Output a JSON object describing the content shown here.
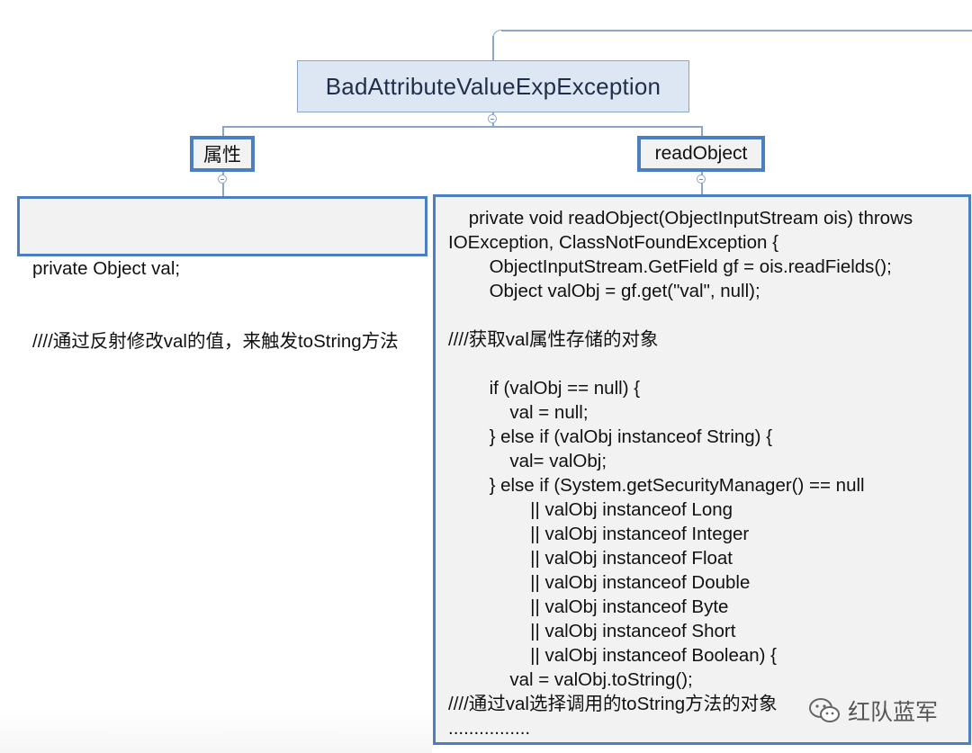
{
  "root": {
    "title": "BadAttributeValueExpException"
  },
  "branches": [
    {
      "label": "属性",
      "content": [
        "private Object val;",
        "////通过反射修改val的值，来触发toString方法"
      ]
    },
    {
      "label": "readObject",
      "content": [
        "    private void readObject(ObjectInputStream ois) throws",
        "IOException, ClassNotFoundException {",
        "        ObjectInputStream.GetField gf = ois.readFields();",
        "        Object valObj = gf.get(\"val\", null);",
        "",
        "////获取val属性存储的对象",
        "",
        "        if (valObj == null) {",
        "            val = null;",
        "        } else if (valObj instanceof String) {",
        "            val= valObj;",
        "        } else if (System.getSecurityManager() == null",
        "                || valObj instanceof Long",
        "                || valObj instanceof Integer",
        "                || valObj instanceof Float",
        "                || valObj instanceof Double",
        "                || valObj instanceof Byte",
        "                || valObj instanceof Short",
        "                || valObj instanceof Boolean) {",
        "            val = valObj.toString();",
        "////通过val选择调用的toString方法的对象",
        "................"
      ]
    }
  ],
  "watermark": {
    "icon": "wechat-icon",
    "text": "红队蓝军"
  },
  "colors": {
    "node_border": "#4b7fc2",
    "root_fill": "#dde7f3",
    "leaf_fill": "#f2f2f2"
  }
}
